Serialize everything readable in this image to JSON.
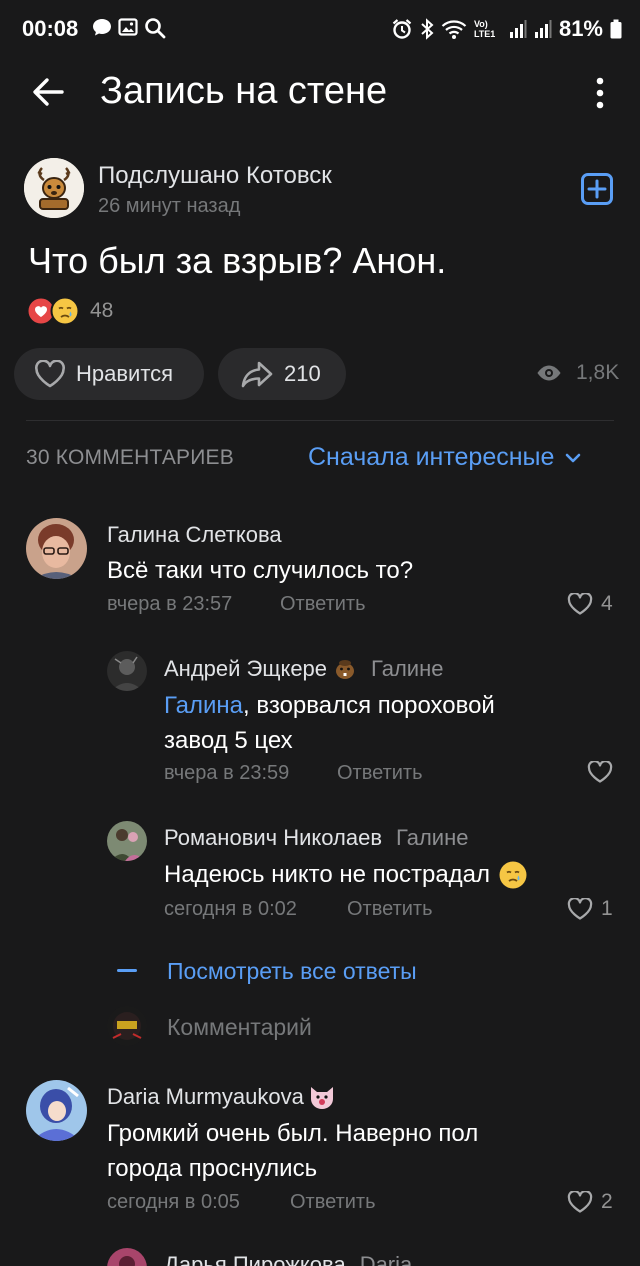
{
  "status_bar": {
    "time": "00:08",
    "battery": "81%",
    "network": "Vo) LTE1"
  },
  "header": {
    "title": "Запись на стене"
  },
  "post": {
    "group_name": "Подслушано Котовск",
    "time": "26 минут назад",
    "text": "Что был за взрыв? Анон.",
    "reactions_count": "48",
    "like_label": "Нравится",
    "shares": "210",
    "views": "1,8K"
  },
  "comments_section": {
    "count_label": "30 КОММЕНТАРИЕВ",
    "sort_label": "Сначала интересные",
    "view_all_replies": "Посмотреть все ответы",
    "input_placeholder": "Комментарий"
  },
  "comments": [
    {
      "author": "Галина Слеткова",
      "text": "Всё таки что случилось то?",
      "time": "вчера в 23:57",
      "reply": "Ответить",
      "likes": "4"
    },
    {
      "author": "Андрей Эщкере",
      "reply_to": "Галине",
      "mention": "Галина",
      "text": ", взорвался пороховой",
      "text2": "завод 5 цех",
      "time": "вчера в 23:59",
      "reply": "Ответить"
    },
    {
      "author": "Романович Николаев",
      "reply_to": "Галине",
      "text": "Надеюсь никто не пострадал",
      "time": "сегодня в 0:02",
      "reply": "Ответить",
      "likes": "1"
    },
    {
      "author": "Daria Murmyaukova",
      "text": "Громкий очень был. Наверно пол",
      "text2": "города проснулись",
      "time": "сегодня в 0:05",
      "reply": "Ответить",
      "likes": "2"
    },
    {
      "author": "Дарья Пирожкова",
      "reply_to": "Daria"
    }
  ],
  "colors": {
    "background": "#19191a",
    "accent": "#5a9ef5",
    "secondary_text": "#76787a"
  }
}
